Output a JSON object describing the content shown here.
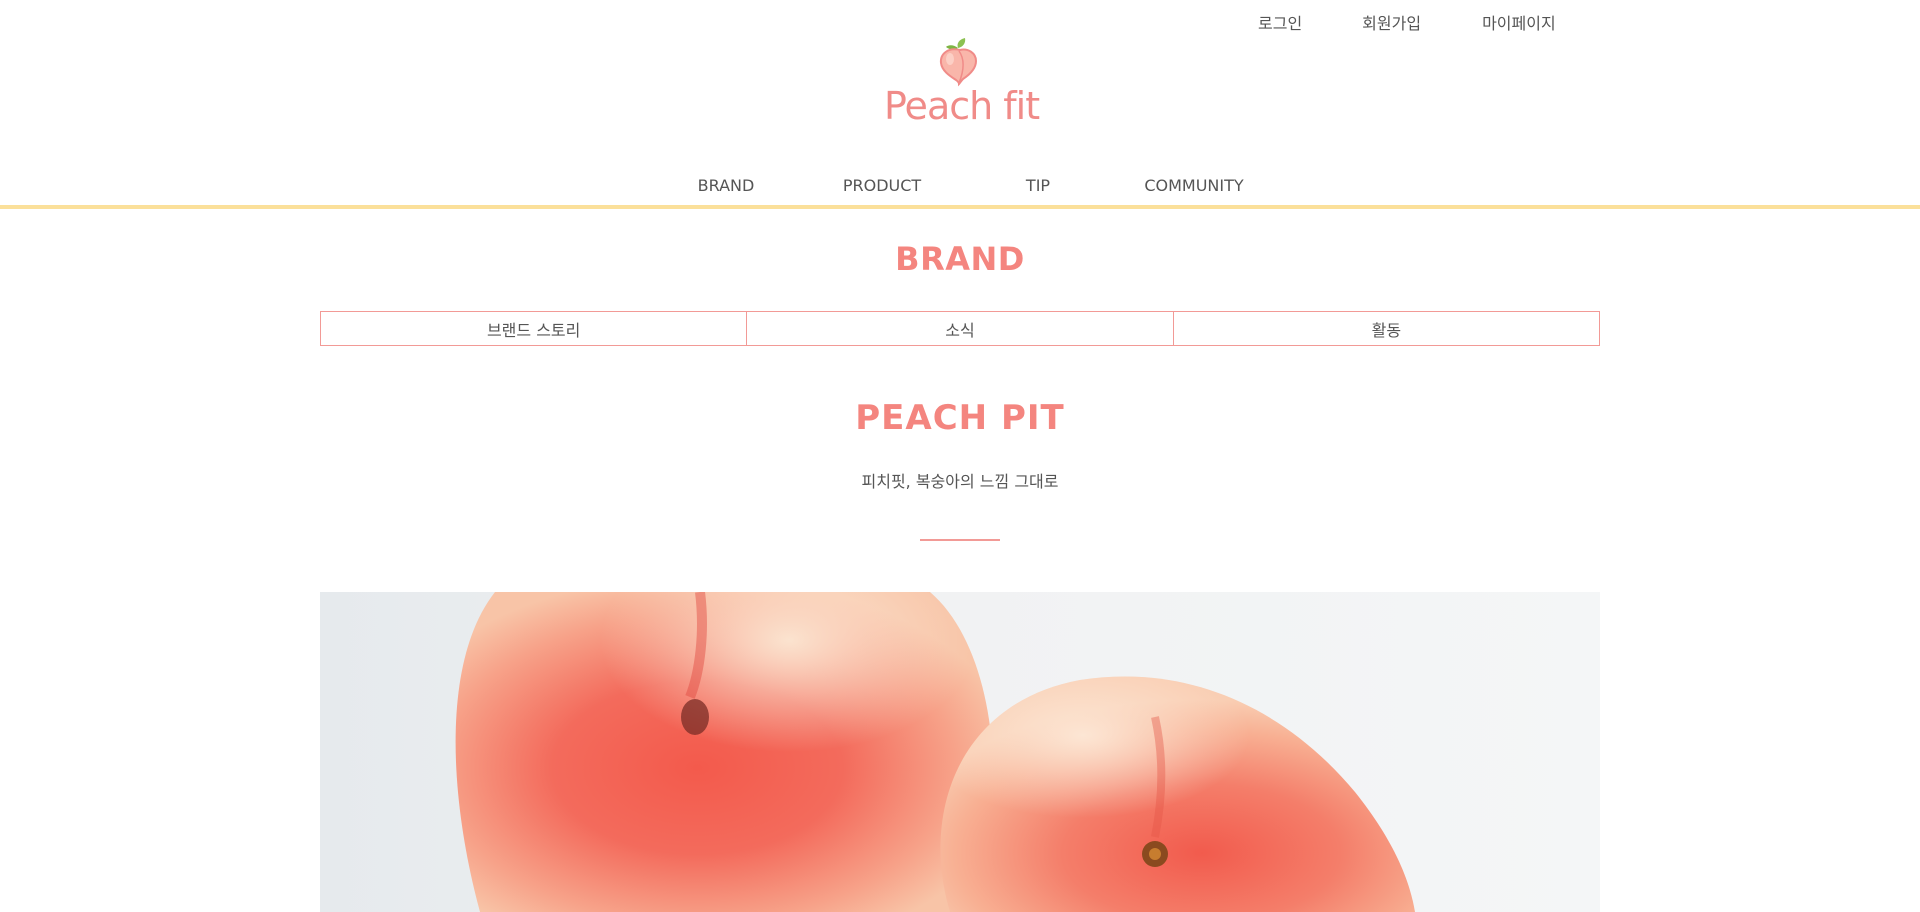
{
  "util_nav": {
    "login": "로그인",
    "join": "회원가입",
    "mypage": "마이페이지"
  },
  "logo": {
    "text": "Peach fit",
    "icon": "peach-icon"
  },
  "gnb": {
    "items": [
      "BRAND",
      "PRODUCT",
      "TIP",
      "COMMUNITY"
    ]
  },
  "section": {
    "title": "BRAND"
  },
  "subtabs": [
    "브랜드 스토리",
    "소식",
    "활동"
  ],
  "content": {
    "title": "PEACH PIT",
    "subtitle": "피치핏, 복숭아의 느낌 그대로"
  },
  "hero": {
    "image": "peaches-photo"
  },
  "colors": {
    "accent": "#f4857f",
    "border": "#f29a96",
    "header_line": "#fbe09a",
    "text": "#555555"
  }
}
